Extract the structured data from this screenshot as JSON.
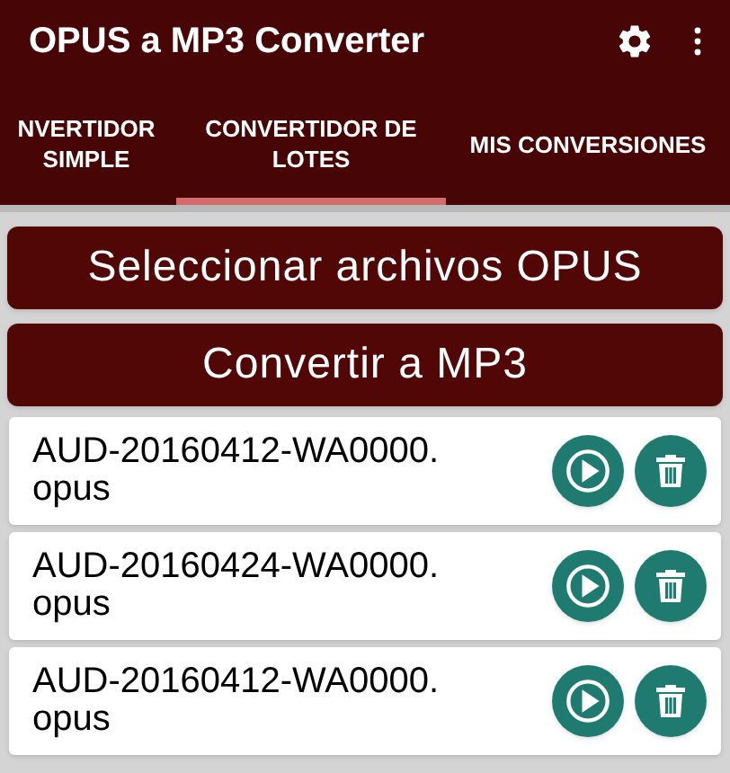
{
  "app_bar": {
    "title": "OPUS a MP3 Converter"
  },
  "tabs": [
    {
      "label": "NVERTIDOR SIMPLE",
      "selected": false
    },
    {
      "label": "CONVERTIDOR DE LOTES",
      "selected": true
    },
    {
      "label": "MIS CONVERSIONES",
      "selected": false
    }
  ],
  "buttons": [
    "Seleccionar archivos OPUS",
    "Convertir a MP3"
  ],
  "files": [
    {
      "name": "AUD-20160412-WA0000.opus"
    },
    {
      "name": "AUD-20160424-WA0000.opus"
    },
    {
      "name": "AUD-20160412-WA0000.opus"
    }
  ]
}
